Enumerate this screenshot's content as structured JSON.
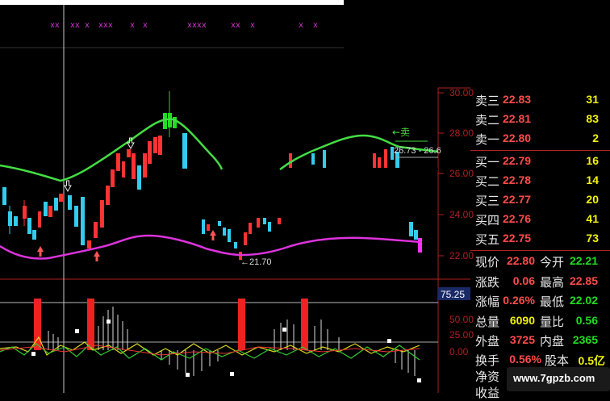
{
  "markers": {
    "top_row": [
      "xx",
      "xx",
      "x",
      "xxx",
      "x",
      "x",
      "xxxx",
      "xx",
      "x",
      "x",
      "x"
    ]
  },
  "main_chart": {
    "y_axis_ticks": [
      "30.00",
      "28.00",
      "26.00",
      "24.00",
      "22.00"
    ],
    "annotations": {
      "sell_arrow": "←卖",
      "band_label": "26.73 - 26.6",
      "low_label": "←21.70"
    }
  },
  "indicator": {
    "value_box": "75.25",
    "y_axis_ticks": [
      "50.00",
      "25.00",
      "0.00"
    ]
  },
  "order_book": {
    "asks": [
      {
        "label": "卖三",
        "price": "22.83",
        "volume": "31"
      },
      {
        "label": "卖二",
        "price": "22.81",
        "volume": "83"
      },
      {
        "label": "卖一",
        "price": "22.80",
        "volume": "2"
      }
    ],
    "bids": [
      {
        "label": "买一",
        "price": "22.79",
        "volume": "16"
      },
      {
        "label": "买二",
        "price": "22.78",
        "volume": "14"
      },
      {
        "label": "买三",
        "price": "22.77",
        "volume": "20"
      },
      {
        "label": "买四",
        "price": "22.76",
        "volume": "41"
      },
      {
        "label": "买五",
        "price": "22.75",
        "volume": "73"
      }
    ]
  },
  "stats": [
    {
      "l1": "现价",
      "v1": "22.80",
      "c1": "#ff4b4b",
      "l2": "今开",
      "v2": "22.21",
      "c2": "#22dd22"
    },
    {
      "l1": "涨跌",
      "v1": "0.06",
      "c1": "#ff4b4b",
      "l2": "最高",
      "v2": "22.85",
      "c2": "#ff4b4b"
    },
    {
      "l1": "涨幅",
      "v1": "0.26%",
      "c1": "#ff4b4b",
      "l2": "最低",
      "v2": "22.02",
      "c2": "#22dd22"
    },
    {
      "l1": "总量",
      "v1": "6090",
      "c1": "#f2f20a",
      "l2": "量比",
      "v2": "0.56",
      "c2": "#22dd22"
    },
    {
      "l1": "外盘",
      "v1": "3725",
      "c1": "#ff4b4b",
      "l2": "内盘",
      "v2": "2365",
      "c2": "#22dd22"
    }
  ],
  "stats_partial": {
    "l1": "换手",
    "v1": "0.56%",
    "l2": "股本",
    "v2": "0.5亿",
    "l3": "净资",
    "l4": "收益"
  },
  "watermark": {
    "text": "www.7gpzb.com"
  },
  "colors": {
    "up": "#ff3333",
    "down": "#33ccee",
    "upper_band": "#44dd44",
    "lower_band": "#dd33dd",
    "axis": "#b02020",
    "marker": "#cc33cc"
  }
}
